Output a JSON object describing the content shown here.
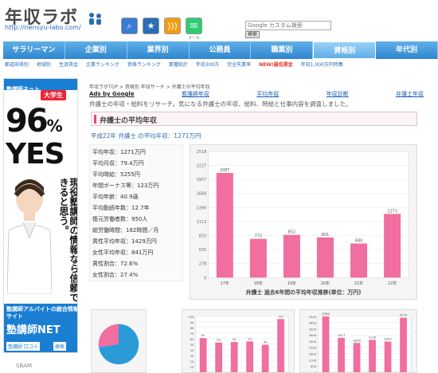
{
  "header": {
    "logo": "年収ラボ",
    "url": "http://nensyu-labo.com/",
    "icons": [
      {
        "name": "search-icon",
        "caption": "",
        "color": "#3a7bd5"
      },
      {
        "name": "bookmark-icon",
        "caption": "",
        "color": "#2a6db5"
      },
      {
        "name": "rss-icon",
        "caption": "",
        "color": "#f39c12"
      },
      {
        "name": "mail-icon",
        "caption": "メール",
        "color": "#2ecc71"
      }
    ],
    "search_placeholder": "Google カスタム検索",
    "search_button": "検索"
  },
  "nav": [
    "サラリーマン",
    "企業別",
    "業界別",
    "公務員",
    "職業別",
    "資格別",
    "年代別"
  ],
  "nav_active": 5,
  "subnav": [
    {
      "label": "都道府県別",
      "new": false
    },
    {
      "label": "地域別",
      "new": false
    },
    {
      "label": "生涯賃金",
      "new": false
    },
    {
      "label": "企業ランキング",
      "new": false
    },
    {
      "label": "資格ランキング",
      "new": false
    },
    {
      "label": "業種統計",
      "new": false
    },
    {
      "label": "年収300万",
      "new": false
    },
    {
      "label": "完全失業率",
      "new": false
    },
    {
      "label": "NEW!最低賃金",
      "new": true
    },
    {
      "label": "年収1,000万円特集",
      "new": false
    }
  ],
  "ad": {
    "top": "塾講師ネット",
    "badge": "大学生",
    "percent": "96",
    "yes": "YES",
    "vertical": "現役塾講師の情報なら信頼できると思う。",
    "b1": "塾講師アルバイトの総合情報サイト",
    "b2": "塾講師NET",
    "b3": "塾講師 口コミ",
    "b4": "検索"
  },
  "breadcrumb": "年収ラボTOP > 資格別 年収サーチ > 弁護士の平均年収",
  "tabs": [
    "Ads by Google",
    "看護師年収",
    "平均年収",
    "年収診断",
    "弁護士年収"
  ],
  "intro": "弁護士の年収・給料をリサーチ。気になる弁護士の年収、給料、時給と仕事内容を調査しました。",
  "section_title": "弁護士の平均年収",
  "highlight": "平成22年 弁護士 の平均年収：1271万円",
  "stats": [
    "平均年収：1271万円",
    "平均月収：79.4万円",
    "平均時給：5255円",
    "年間ボーナス等：123万円",
    "平均年齢：40.9歳",
    "平均勤続年数：12.7年",
    "復元労働者数：950人",
    "総労働時間：182時間／月",
    "男性平均年収：1429万円",
    "女性平均年収：841万円",
    "男性割合：72.6%",
    "女性割合：27.4%"
  ],
  "sbam": "SBAM",
  "chart_data": [
    {
      "type": "bar",
      "title": "弁護士 過去6年間の平均年収推移(単位：万円)",
      "categories": [
        "17年",
        "18年",
        "19年",
        "20年",
        "21年",
        "22年"
      ],
      "values": [
        2087,
        772,
        852,
        801,
        680,
        1271
      ],
      "ylim": [
        0,
        2518
      ],
      "yticks": [
        "2518",
        "2227",
        "1957",
        "1668",
        "1390",
        "1113",
        "833",
        "555",
        "278",
        "0"
      ],
      "color": "#f06ea0"
    },
    {
      "type": "pie",
      "values": [
        72.6,
        27.4
      ],
      "colors": [
        "#2b9bd8",
        "#f06ea0"
      ]
    },
    {
      "type": "bar",
      "title": "",
      "categories": [
        "17",
        "18",
        "19",
        "20",
        "21",
        "22"
      ],
      "series": [
        {
          "values": [
            61,
            53,
            54,
            55,
            49,
            95
          ]
        }
      ],
      "ylim": [
        0,
        100
      ],
      "yticks": [
        "100",
        "90",
        "80",
        "70",
        "60",
        "50",
        "40",
        "30",
        "20",
        "10",
        "0"
      ],
      "color": "#f06ea0"
    },
    {
      "type": "bar",
      "title": "",
      "categories": [
        "17",
        "18",
        "19",
        "20",
        "21",
        "22"
      ],
      "series": [
        {
          "values": [
            5380,
            3317,
            2828,
            3130,
            2952,
            5255
          ]
        }
      ],
      "ylim": [
        0,
        5400
      ],
      "yticks": [
        "5400",
        "4800",
        "4200",
        "3600",
        "3000",
        "2400",
        "1800",
        "1200",
        "600",
        "0"
      ],
      "color": "#f06ea0"
    }
  ]
}
